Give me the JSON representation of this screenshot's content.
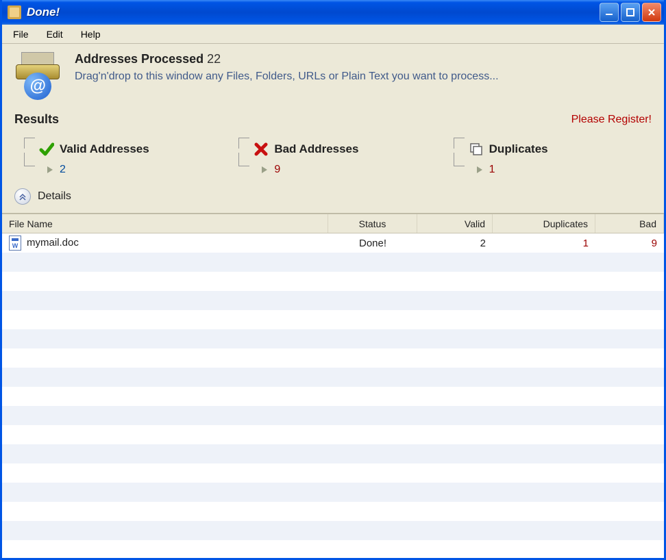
{
  "window": {
    "title": "Done!"
  },
  "menu": {
    "file": "File",
    "edit": "Edit",
    "help": "Help"
  },
  "header": {
    "title_bold": "Addresses Processed",
    "count": "22",
    "hint": "Drag'n'drop to this window any Files, Folders, URLs or Plain Text you want to process..."
  },
  "results": {
    "label": "Results",
    "register": "Please Register!"
  },
  "stats": {
    "valid": {
      "label": "Valid Addresses",
      "value": "2"
    },
    "bad": {
      "label": "Bad Addresses",
      "value": "9"
    },
    "dup": {
      "label": "Duplicates",
      "value": "1"
    }
  },
  "details": {
    "label": "Details"
  },
  "table": {
    "headers": {
      "filename": "File Name",
      "status": "Status",
      "valid": "Valid",
      "duplicates": "Duplicates",
      "bad": "Bad"
    },
    "rows": [
      {
        "filename": "mymail.doc",
        "status": "Done!",
        "valid": "2",
        "duplicates": "1",
        "bad": "9"
      }
    ]
  }
}
